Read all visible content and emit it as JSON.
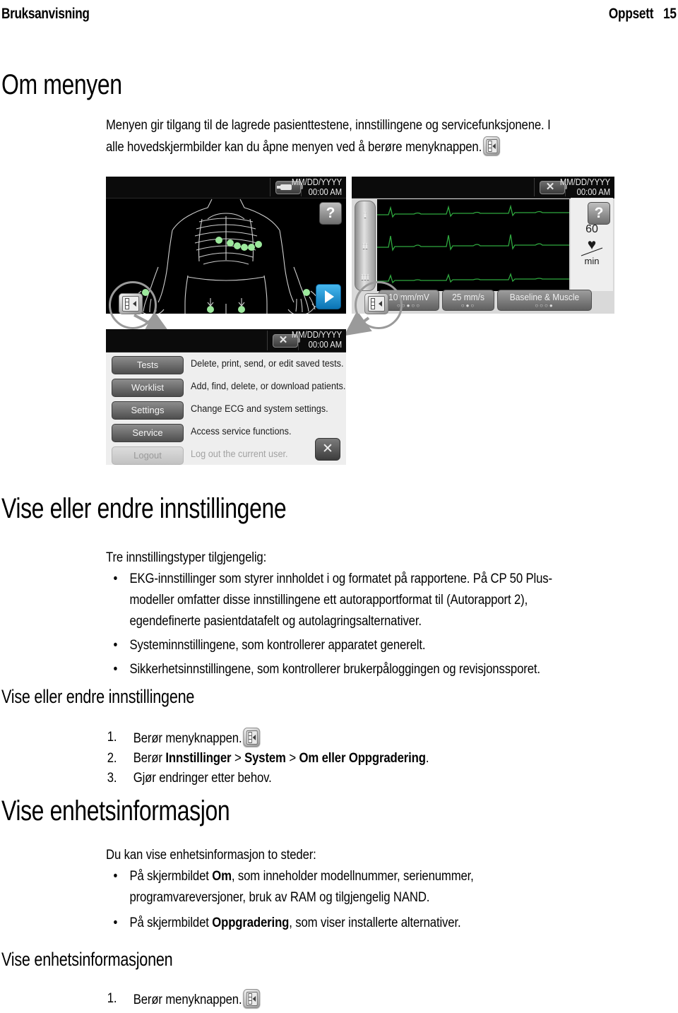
{
  "header": {
    "left": "Bruksanvisning",
    "section": "Oppsett",
    "page_number": "15"
  },
  "sections": {
    "om_menyen": {
      "title": "Om menyen",
      "paragraph_line1": "Menyen gir tilgang til de lagrede pasienttestene, innstillingene og servicefunksjonene. I",
      "paragraph_line2": "alle hovedskjermbilder kan du åpne menyen ved å berøre menyknappen."
    },
    "vise_endre_innstillingene": {
      "title": "Vise eller endre innstillingene",
      "intro": "Tre innstillingstyper tilgjengelig:",
      "bullets": [
        "EKG-innstillinger som styrer innholdet i og formatet på rapportene. På CP 50 Plus-modeller omfatter disse innstillingene ett autorapportformat til (Autorapport 2), egendefinerte pasientdatafelt og autolagringsalternativer.",
        "Systeminnstillingene, som kontrollerer apparatet generelt.",
        "Sikkerhetsinnstillingene, som kontrollerer brukerpåloggingen og revisjonssporet."
      ],
      "bullet1_line1": "EKG-innstillinger som styrer innholdet i og formatet på rapportene. På CP 50 Plus-",
      "bullet1_line2": "modeller omfatter disse innstillingene ett autorapportformat til (Autorapport 2),",
      "bullet1_line3": "egendefinerte pasientdatafelt og autolagringsalternativer.",
      "bullet_marker": "•"
    },
    "vise_endre_sub": {
      "title": "Vise eller endre innstillingene",
      "steps": [
        {
          "num": "1.",
          "text_before": "Berør menyknappen.",
          "has_icon": true
        },
        {
          "num": "2.",
          "text_before": "Berør ",
          "bold1": "Innstillinger",
          "sep1": " > ",
          "bold2": "System",
          "sep2": " > ",
          "bold3": "Om eller Oppgradering",
          "text_after": "."
        },
        {
          "num": "3.",
          "text_before": "Gjør endringer etter behov.",
          "has_icon": false
        }
      ]
    },
    "vise_enhetsinformasjon": {
      "title": "Vise enhetsinformasjon",
      "intro": "Du kan vise enhetsinformasjon to steder:",
      "bullet1_pre": "På skjermbildet ",
      "bullet1_bold": "Om",
      "bullet1_post": ", som inneholder modellnummer, serienummer,",
      "bullet1_line2": "programvareversjoner, bruk av RAM og tilgjengelig NAND.",
      "bullet2_pre": "På skjermbildet ",
      "bullet2_bold": "Oppgradering",
      "bullet2_post": ", som viser installerte alternativer."
    },
    "vise_enhetsinformasjonen": {
      "title": "Vise enhetsinformasjonen",
      "step1_num": "1.",
      "step1_text": "Berør menyknappen."
    }
  },
  "figure": {
    "electrode_screen": {
      "name": "electrode-placement-screen",
      "date": "MM/DD/YYYY",
      "time": "00:00 AM",
      "help_label": "?",
      "battery_icon": "battery-plug-icon",
      "next_icon": "play-arrow-icon",
      "menu_icon": "menu-button-icon"
    },
    "ecg_screen": {
      "name": "ecg-waveform-screen",
      "date": "MM/DD/YYYY",
      "time": "00:00 AM",
      "help_label": "?",
      "battery_icon": "battery-disconnected-icon",
      "leads": [
        "I",
        "II",
        "III"
      ],
      "hr_value": "60",
      "hr_heart": "♥",
      "hr_unit": "min",
      "buttons": [
        {
          "label": "10 mm/mV",
          "dots": "○○●○○"
        },
        {
          "label": "25 mm/s",
          "dots": "○●○"
        },
        {
          "label": "Baseline & Muscle",
          "dots": "○○○●"
        }
      ]
    },
    "menu_screen": {
      "name": "main-menu-screen",
      "date": "MM/DD/YYYY",
      "time": "00:00 AM",
      "close_label": "✕",
      "rows": [
        {
          "button": "Tests",
          "description": "Delete, print, send, or edit saved tests.",
          "disabled": false
        },
        {
          "button": "Worklist",
          "description": "Add, find, delete, or download patients.",
          "disabled": false
        },
        {
          "button": "Settings",
          "description": "Change ECG and system settings.",
          "disabled": false
        },
        {
          "button": "Service",
          "description": "Access service functions.",
          "disabled": false
        },
        {
          "button": "Logout",
          "description": "Log out the current user.",
          "disabled": true
        }
      ]
    }
  },
  "colors": {
    "ecg_trace": "#2fa83f",
    "electrode_dot": "#9ce89c",
    "next_button": "#1b8fd0",
    "callout_ring": "#9a9a9a",
    "screen_black": "#000000"
  }
}
